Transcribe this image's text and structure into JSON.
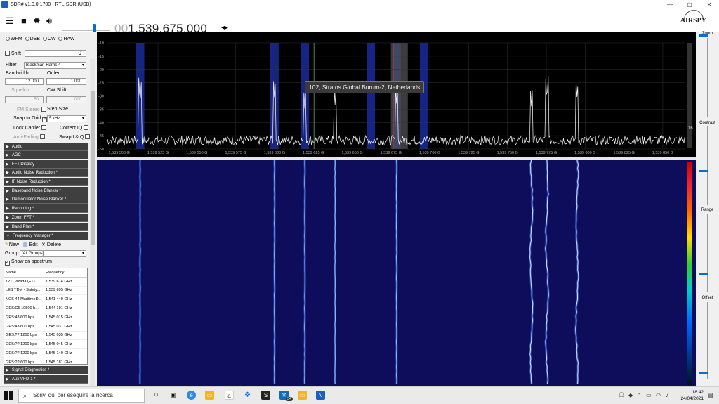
{
  "window": {
    "title": "SDR# v1.0.0.1700 - RTL-SDR (USB)",
    "controls": [
      "—",
      "▢",
      "✕"
    ]
  },
  "toolbar": {
    "frequency_lead": "00",
    "frequency_rest": "1.539.675.000",
    "arrows": "◂▸",
    "brand": "AIRSPY"
  },
  "modes": [
    "WFM",
    "DSB",
    "CW",
    "RAW"
  ],
  "controls": {
    "shift_label": "Shift",
    "shift_value": "0",
    "filter_label": "Filter",
    "filter_value": "Blackman-Harris 4",
    "bandwidth_label": "Bandwidth",
    "bandwidth_value": "12.000",
    "order_label": "Order",
    "order_value": "1.000",
    "squelch_label": "Squelch",
    "squelch_value": "50",
    "cwshift_label": "CW Shift",
    "cwshift_value": "1.000",
    "fmstereo_label": "FM Stereo",
    "stepsize_label": "Step Size",
    "snap_label": "Snap to Grid",
    "snap_value": "5 kHz",
    "lockcarrier_label": "Lock Carrier",
    "correctiq_label": "Correct IQ",
    "antifading_label": "Anti-Fading",
    "swapiq_label": "Swap I & Q"
  },
  "sections": [
    {
      "label": "Audio",
      "open": false
    },
    {
      "label": "AGC",
      "open": false
    },
    {
      "label": "FFT Display",
      "open": false
    },
    {
      "label": "Audio Noise Reduction *",
      "open": false
    },
    {
      "label": "IF Noise Reduction *",
      "open": false
    },
    {
      "label": "Baseband Noise Blanker *",
      "open": false
    },
    {
      "label": "Demodulator Noise Blanker *",
      "open": false
    },
    {
      "label": "Recording *",
      "open": false
    },
    {
      "label": "Zoom FFT *",
      "open": false
    },
    {
      "label": "Band Plan *",
      "open": false
    },
    {
      "label": "Frequency Manager *",
      "open": true
    }
  ],
  "freq_manager": {
    "new_label": "New",
    "edit_label": "Edit",
    "delete_label": "Delete",
    "group_label": "Group:",
    "group_value": "[All Groups]",
    "show_label": "Show on spectrum",
    "col_name": "Name",
    "col_freq": "Frequency",
    "rows": [
      {
        "name": "121, Vizada (FT)...",
        "freq": "1,539 674 GHz"
      },
      {
        "name": "LES TDM - Safety...",
        "freq": "1,539 695 GHz"
      },
      {
        "name": "NCS 44 MaritimeD...",
        "freq": "1,541 449 GHz"
      },
      {
        "name": "GES:C5 10500 b...",
        "freq": "1,544 191 GHz"
      },
      {
        "name": "GES:43 600 bps",
        "freq": "1,545 015 GHz"
      },
      {
        "name": "GES:43 600 bps",
        "freq": "1,545 031 GHz"
      },
      {
        "name": "GES:?? 1200 bps",
        "freq": "1,545 035 GHz"
      },
      {
        "name": "GES:?? 1200 bps",
        "freq": "1,545 045 GHz"
      },
      {
        "name": "GES:?? 1200 bps",
        "freq": "1,545 140 GHz"
      },
      {
        "name": "GES:?? 600 bps",
        "freq": "1,545 181 GHz"
      }
    ]
  },
  "bottom_sections": [
    {
      "label": "Signal Diagnostics *"
    },
    {
      "label": "Aux VFO-1 *"
    }
  ],
  "spectrum": {
    "y_ticks": [
      "-10",
      "-15",
      "-20",
      "-25",
      "-30",
      "-35",
      "-40",
      "-45",
      "-50"
    ],
    "x_ticks": [
      "1,539 500 G",
      "1,539 525 G",
      "1,539 550 G",
      "1,539 575 G",
      "1,539 600 G",
      "1,539 625 G",
      "1,539 650 G",
      "1,539 675 G",
      "1,539 700 G",
      "1,539 725 G",
      "1,539 750 G",
      "1,539 775 G",
      "1,539 800 G",
      "1,539 825 G",
      "1,539 850 G"
    ],
    "side_value": "16",
    "tooltip": "102, Stratos Global Burum-2, Netherlands",
    "peaks_mhz": [
      1539.5135,
      1539.6,
      1539.6195,
      1539.639,
      1539.6786,
      1539.7654,
      1539.7754,
      1539.7948
    ],
    "peak_db": [
      -33,
      -31,
      -35,
      -33.5,
      -33,
      -34,
      -32,
      -31.5
    ],
    "bands_mhz": [
      1539.5135,
      1539.6,
      1539.6195,
      1539.662,
      1539.6786,
      1539.6963
    ],
    "colors": {
      "band": "#1a2a9a",
      "trace": "#ffffff",
      "center": "#ff3030",
      "waterfall_bg": "#0d0d5c"
    }
  },
  "right_panel": {
    "zoom": "Zoom",
    "contrast": "Contrast",
    "range": "Range",
    "offset": "Offset"
  },
  "taskbar": {
    "search_placeholder": "Scrivi qui per eseguire la ricerca",
    "mail_badge": "34",
    "time": "18:42",
    "date": "24/04/2021"
  }
}
